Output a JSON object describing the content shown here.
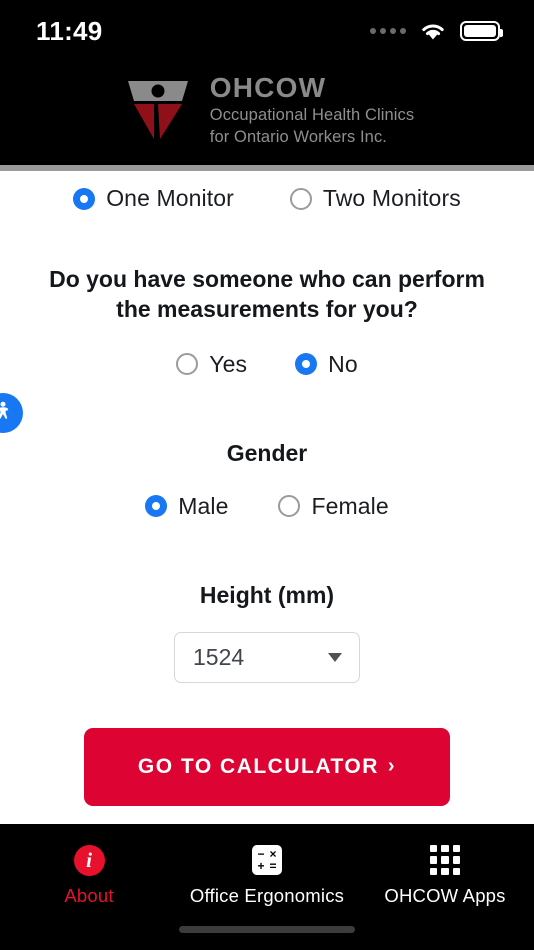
{
  "status_bar": {
    "time": "11:49",
    "signal_icon": "signal-dots-icon",
    "wifi_icon": "wifi-icon",
    "battery_icon": "battery-full-icon"
  },
  "header": {
    "logo_icon": "ohcow-logo-icon",
    "org_acronym": "OHCOW",
    "org_name_line1": "Occupational Health Clinics",
    "org_name_line2": "for Ontario Workers Inc.",
    "accent_gray": "#8a8a8a",
    "accent_red": "#8f1018"
  },
  "accessibility_fab": {
    "icon": "accessibility-person-icon",
    "color": "#1877f2"
  },
  "form": {
    "monitor_group": {
      "options": [
        {
          "label": "One Monitor",
          "selected": true
        },
        {
          "label": "Two Monitors",
          "selected": false
        }
      ]
    },
    "helper_question": {
      "text": "Do you have someone who can perform the measurements for you?",
      "options": [
        {
          "label": "Yes",
          "selected": false
        },
        {
          "label": "No",
          "selected": true
        }
      ]
    },
    "gender": {
      "title": "Gender",
      "options": [
        {
          "label": "Male",
          "selected": true
        },
        {
          "label": "Female",
          "selected": false
        }
      ]
    },
    "height": {
      "title": "Height (mm)",
      "value": "1524",
      "dropdown_icon": "chevron-down-icon"
    },
    "submit": {
      "label": "GO TO CALCULATOR",
      "chevron": "›",
      "color": "#dd0433"
    },
    "radio_selected_color": "#1877f2"
  },
  "bottom_nav": {
    "items": [
      {
        "label": "About",
        "icon": "info-icon",
        "active": true
      },
      {
        "label": "Office Ergonomics",
        "icon": "calculator-icon",
        "active": false
      },
      {
        "label": "OHCOW Apps",
        "icon": "grid-apps-icon",
        "active": false
      }
    ],
    "active_color": "#e8112d"
  }
}
